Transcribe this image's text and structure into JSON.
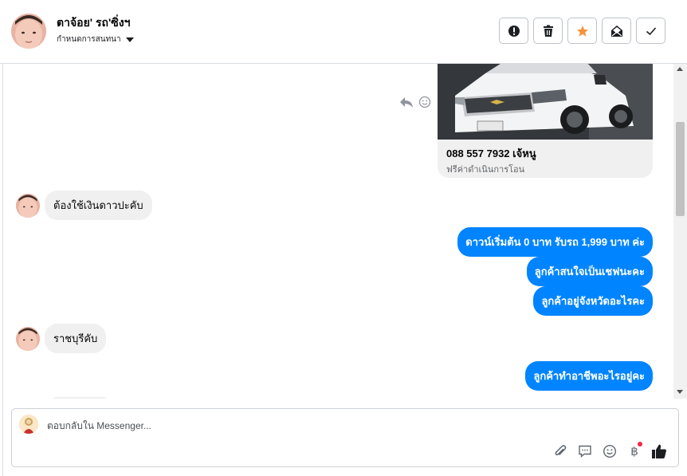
{
  "header": {
    "name": "ตาจ้อย' รถ'ซิ่งฯ",
    "subtitle": "กำหนดการสนทนา",
    "actions": [
      "alert-icon",
      "trash-icon",
      "star-icon",
      "mark-unread-icon",
      "check-icon"
    ],
    "star_color": "#f7923a"
  },
  "conversation": {
    "attachment": {
      "title": "088 557 7932 เจ้หนู",
      "description": "ฟรีค่าดำเนินการโอน"
    },
    "messages": [
      {
        "from": "customer",
        "text": "ต้องใช้เงินดาวปะคับ"
      },
      {
        "from": "page",
        "text": "ดาวน์เริ่มต้น 0 บาท รับรถ 1,999 บาท ค่ะ"
      },
      {
        "from": "page",
        "text": "ลูกค้าสนใจเป็นเชฟนะคะ"
      },
      {
        "from": "page",
        "text": "ลูกค้าอยู่จังหวัดอะไรคะ"
      },
      {
        "from": "customer",
        "text": "ราชบุรีคับ"
      },
      {
        "from": "page",
        "text": "ลูกค้าทำอาชีพอะไรอยู่คะ"
      }
    ],
    "bubble_color": "#0084ff"
  },
  "composer": {
    "placeholder": "ตอบกลับใน Messenger...",
    "tools": [
      "paperclip-icon",
      "saved-reply-icon",
      "emoji-icon",
      "baht-icon",
      "thumbs-up-icon"
    ],
    "baht_symbol": "฿"
  }
}
